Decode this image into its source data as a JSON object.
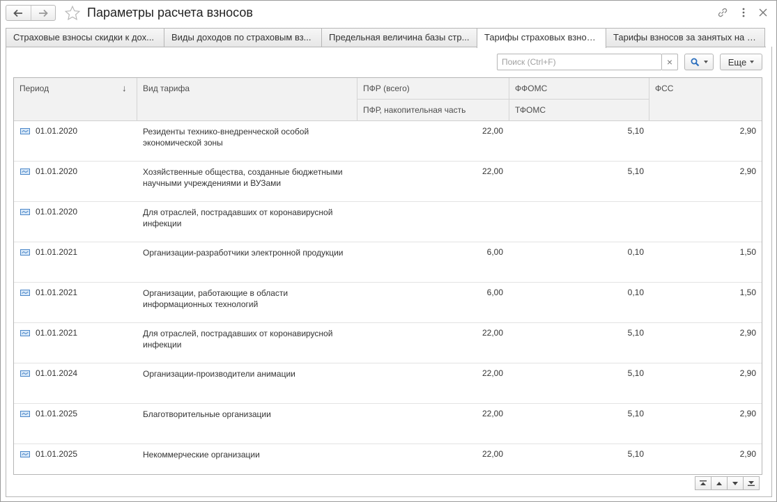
{
  "window": {
    "title": "Параметры расчета взносов"
  },
  "tabs": [
    {
      "label": "Страховые взносы скидки к дох...",
      "active": false
    },
    {
      "label": "Виды доходов по страховым вз...",
      "active": false
    },
    {
      "label": "Предельная величина базы стр...",
      "active": false
    },
    {
      "label": "Тарифы страховых взносов",
      "active": true
    },
    {
      "label": "Тарифы взносов за занятых на р...",
      "active": false
    }
  ],
  "toolbar": {
    "search_placeholder": "Поиск (Ctrl+F)",
    "clear_label": "×",
    "more_label": "Еще"
  },
  "table": {
    "headers": {
      "period": "Период",
      "sort_arrow": "↓",
      "kind": "Вид тарифа",
      "pfr_total": "ПФР (всего)",
      "pfr_funded": "ПФР, накопительная часть",
      "ffoms": "ФФОМС",
      "tfoms": "ТФОМС",
      "fss": "ФСС"
    },
    "rows": [
      {
        "period": "01.01.2020",
        "kind": "Резиденты технико-внедренческой особой экономической зоны",
        "pfr": "22,00",
        "ffoms": "5,10",
        "fss": "2,90"
      },
      {
        "period": "01.01.2020",
        "kind": "Хозяйственные общества, созданные бюджетными научными учреждениями и ВУЗами",
        "pfr": "22,00",
        "ffoms": "5,10",
        "fss": "2,90"
      },
      {
        "period": "01.01.2020",
        "kind": "Для отраслей, пострадавших от коронавирусной инфекции",
        "pfr": "",
        "ffoms": "",
        "fss": ""
      },
      {
        "period": "01.01.2021",
        "kind": "Организации-разработчики электронной продукции",
        "pfr": "6,00",
        "ffoms": "0,10",
        "fss": "1,50"
      },
      {
        "period": "01.01.2021",
        "kind": "Организации, работающие в области информационных технологий",
        "pfr": "6,00",
        "ffoms": "0,10",
        "fss": "1,50"
      },
      {
        "period": "01.01.2021",
        "kind": "Для отраслей, пострадавших от коронавирусной инфекции",
        "pfr": "22,00",
        "ffoms": "5,10",
        "fss": "2,90"
      },
      {
        "period": "01.01.2024",
        "kind": "Организации-производители анимации",
        "pfr": "22,00",
        "ffoms": "5,10",
        "fss": "2,90"
      },
      {
        "period": "01.01.2025",
        "kind": "Благотворительные организации",
        "pfr": "22,00",
        "ffoms": "5,10",
        "fss": "2,90"
      },
      {
        "period": "01.01.2025",
        "kind": "Некоммерческие организации",
        "pfr": "22,00",
        "ffoms": "5,10",
        "fss": "2,90"
      }
    ]
  },
  "colors": {
    "accent_icon": "#4a86c8",
    "border": "#b5b5b5",
    "header_bg": "#f2f2f2"
  }
}
